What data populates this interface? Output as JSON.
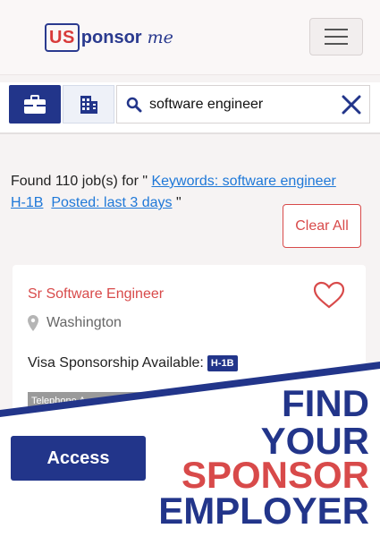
{
  "header": {
    "logo_us": "US",
    "logo_rest": "ponsor",
    "logo_script": "me",
    "menu_icon": "hamburger-icon"
  },
  "search": {
    "jobs_tab_icon": "briefcase-icon",
    "companies_tab_icon": "building-icon",
    "query": "software engineer",
    "clear_icon": "close-icon"
  },
  "results": {
    "prefix": "Found 110 job(s) for \" ",
    "filter_keywords": "Keywords: software engineer",
    "filter_visa": "H-1B",
    "filter_posted": "Posted: last 3 days",
    "suffix": " \"",
    "clear_all": "Clear All"
  },
  "job": {
    "title": "Sr Software Engineer",
    "location": "Washington",
    "visa_label": "Visa Sponsorship Available:",
    "visa_badge": "H-1B",
    "tag": "Telephone A..."
  },
  "promo": {
    "access_button": "Access",
    "line1": "FIND",
    "line2": "YOUR",
    "line3": "SPONSOR",
    "line4": "EMPLOYER"
  },
  "colors": {
    "brand_blue": "#22358a",
    "brand_red": "#d84a4a",
    "link_blue": "#1e78d8"
  }
}
